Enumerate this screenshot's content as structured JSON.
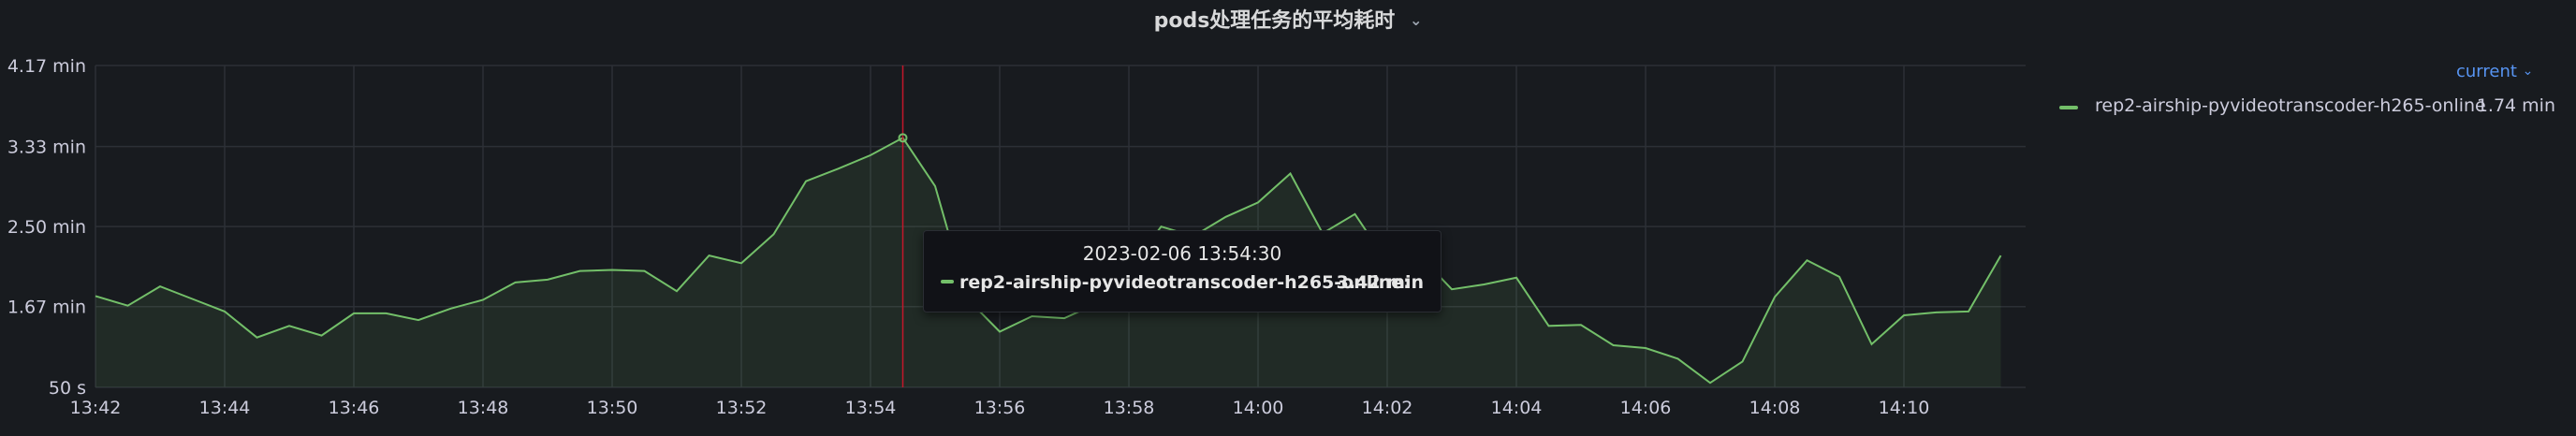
{
  "panel": {
    "title": "pods处理任务的平均耗时",
    "title_icon": "chevron-down-icon"
  },
  "legend": {
    "mode_label": "current",
    "mode_icon": "chevron-down-icon",
    "series_name": "rep2-airship-pyvideotranscoder-h265-online",
    "series_value": "1.74 min",
    "series_color": "#73bf69"
  },
  "tooltip": {
    "time": "2023-02-06 13:54:30",
    "series_name": "rep2-airship-pyvideotranscoder-h265-online:",
    "value": "3.42 min"
  },
  "chart_data": {
    "type": "area",
    "grid": true,
    "legend_position": "right",
    "series_color": "#73bf69",
    "cursor_color": "#c4162a",
    "cursor_time": "13:54:30",
    "x_ticks": [
      "13:42",
      "13:44",
      "13:46",
      "13:48",
      "13:50",
      "13:52",
      "13:54",
      "13:56",
      "13:58",
      "14:00",
      "14:02",
      "14:04",
      "14:06",
      "14:08",
      "14:10"
    ],
    "x_tick_minutes": [
      0,
      2,
      4,
      6,
      8,
      10,
      12,
      14,
      16,
      18,
      20,
      22,
      24,
      26,
      28
    ],
    "y_ticks": [
      {
        "value": 0.833,
        "label": "50 s"
      },
      {
        "value": 1.67,
        "label": "1.67 min"
      },
      {
        "value": 2.5,
        "label": "2.50 min"
      },
      {
        "value": 3.33,
        "label": "3.33 min"
      },
      {
        "value": 4.17,
        "label": "4.17 min"
      }
    ],
    "x_range_minutes": [
      0,
      30
    ],
    "y_range": [
      0.833,
      4.17
    ],
    "series": [
      {
        "name": "rep2-airship-pyvideotranscoder-h265-online",
        "x_minutes": [
          0,
          0.5,
          1,
          1.5,
          2,
          2.5,
          3,
          3.5,
          4,
          4.5,
          5,
          5.5,
          6,
          6.5,
          7,
          7.5,
          8,
          8.5,
          9,
          9.5,
          10,
          10.5,
          11,
          11.5,
          12,
          12.5,
          13,
          13.5,
          14,
          14.5,
          15,
          15.5,
          16,
          16.5,
          17,
          17.5,
          18,
          18.5,
          19,
          19.5,
          20,
          20.5,
          21,
          21.5,
          22,
          22.5,
          23,
          23.5,
          24,
          24.5,
          25,
          25.5,
          26,
          26.5,
          27,
          27.5,
          28,
          28.5,
          29,
          29.5
        ],
        "values": [
          1.78,
          1.68,
          1.88,
          1.75,
          1.62,
          1.35,
          1.47,
          1.37,
          1.6,
          1.6,
          1.53,
          1.65,
          1.74,
          1.92,
          1.95,
          2.04,
          2.05,
          2.04,
          1.83,
          2.2,
          2.12,
          2.42,
          2.97,
          3.1,
          3.24,
          3.42,
          2.92,
          1.75,
          1.41,
          1.57,
          1.55,
          1.7,
          2.05,
          2.5,
          2.4,
          2.6,
          2.75,
          3.05,
          2.43,
          2.63,
          2.13,
          2.2,
          1.85,
          1.9,
          1.97,
          1.47,
          1.48,
          1.27,
          1.24,
          1.13,
          0.88,
          1.1,
          1.77,
          2.15,
          1.98,
          1.28,
          1.58,
          1.61,
          1.62,
          2.2
        ]
      }
    ]
  }
}
